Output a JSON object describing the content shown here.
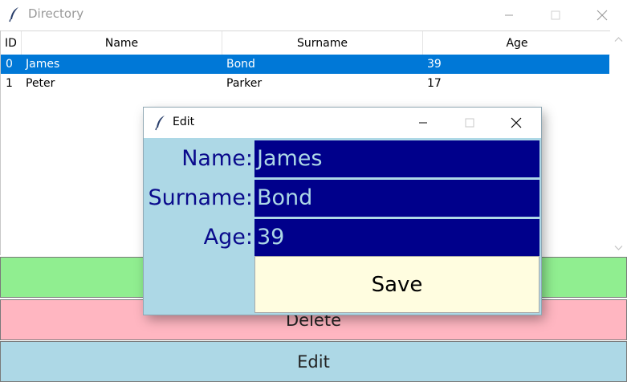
{
  "main_window": {
    "title": "Directory",
    "icon": "feather-icon"
  },
  "table": {
    "columns": [
      "ID",
      "Name",
      "Surname",
      "Age"
    ],
    "rows": [
      {
        "id": "0",
        "name": "James",
        "surname": "Bond",
        "age": "39",
        "selected": true
      },
      {
        "id": "1",
        "name": "Peter",
        "surname": "Parker",
        "age": "17",
        "selected": false
      }
    ]
  },
  "buttons": {
    "add_label": "",
    "delete_label": "Delete",
    "edit_label": "Edit"
  },
  "edit_dialog": {
    "title": "Edit",
    "icon": "feather-icon",
    "fields": {
      "name_label": "Name:",
      "name_value": "James",
      "surname_label": "Surname:",
      "surname_value": "Bond",
      "age_label": "Age:",
      "age_value": "39"
    },
    "save_label": "Save"
  },
  "colors": {
    "selection": "#0078d7",
    "add_button": "#90ee90",
    "delete_button": "#ffb6c1",
    "edit_button": "#add8e6",
    "dialog_bg": "#add8e6",
    "input_bg": "#00008b",
    "input_text": "#add8e6",
    "save_button": "#fffde0"
  }
}
